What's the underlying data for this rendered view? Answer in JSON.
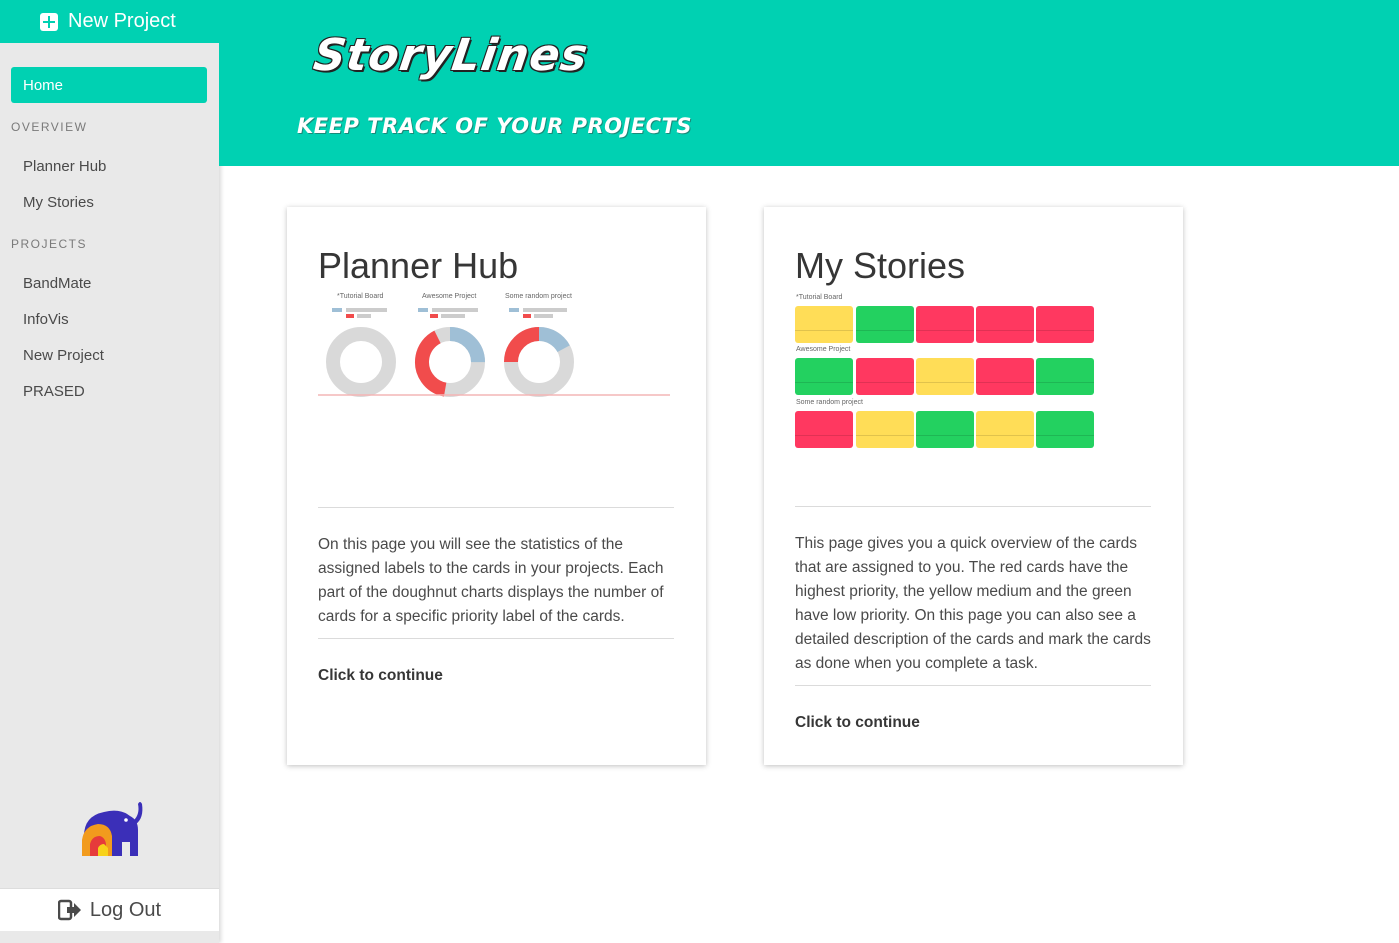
{
  "sidebar": {
    "new_project_label": "New Project",
    "home_label": "Home",
    "overview_label": "OVERVIEW",
    "overview_items": [
      "Planner Hub",
      "My Stories"
    ],
    "projects_label": "PROJECTS",
    "project_items": [
      "BandMate",
      "InfoVis",
      "New Project",
      "PRASED"
    ],
    "logout_label": "Log Out"
  },
  "header": {
    "brand": "StoryLines",
    "tagline": "KEEP TRACK OF YOUR PROJECTS",
    "color": "#00d1b2"
  },
  "cards": {
    "planner": {
      "title": "Planner Hub",
      "text": "On this page you will see the statistics of the assigned labels to the cards in your projects. Each part of the doughnut charts displays the number of cards for a specific priority label of the cards.",
      "link": "Click to continue",
      "preview_charts": [
        {
          "caption": "*Tutorial Board"
        },
        {
          "caption": "Awesome Project"
        },
        {
          "caption": "Some random project"
        }
      ]
    },
    "stories": {
      "title": "My Stories",
      "text": "This page gives you a quick overview of the cards that are assigned to you. The red cards have the highest priority, the yellow medium and the green have low priority. On this page you can also see a detailed description of the cards and mark the cards as done when you complete a task.",
      "link": "Click to continue",
      "preview_rows": [
        {
          "label": "*Tutorial Board"
        },
        {
          "label": "Awesome Project"
        },
        {
          "label": "Some random project"
        }
      ]
    }
  },
  "colors": {
    "accent": "#00d1b2",
    "red": "#ff3860",
    "yellow": "#ffdd57",
    "green": "#23d160",
    "chart_red": "#f14c4c",
    "chart_blue": "#9fbfd6",
    "chart_grey": "#d9d9d9"
  }
}
